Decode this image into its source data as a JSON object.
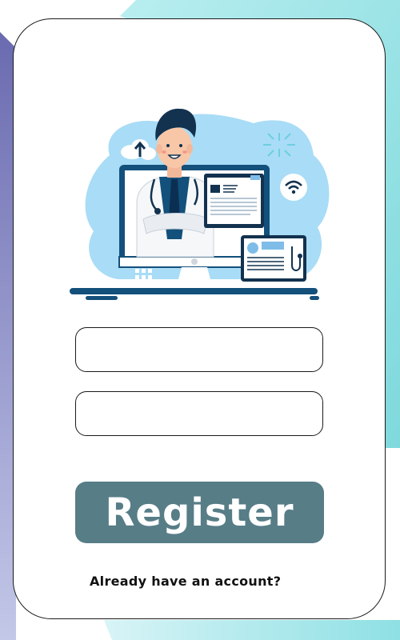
{
  "form": {
    "field1": {
      "value": "",
      "placeholder": ""
    },
    "field2": {
      "value": "",
      "placeholder": ""
    },
    "register_label": "Register",
    "login_link_label": "Already have an account?"
  },
  "illustration": {
    "name": "doctor-telemedicine-illustration"
  },
  "colors": {
    "button": "#577d87",
    "accent_teal": "#7fd9dc",
    "accent_purple": "#6f6fb0",
    "illustration_blue": "#a9dcf6",
    "illustration_navy": "#13507b"
  }
}
